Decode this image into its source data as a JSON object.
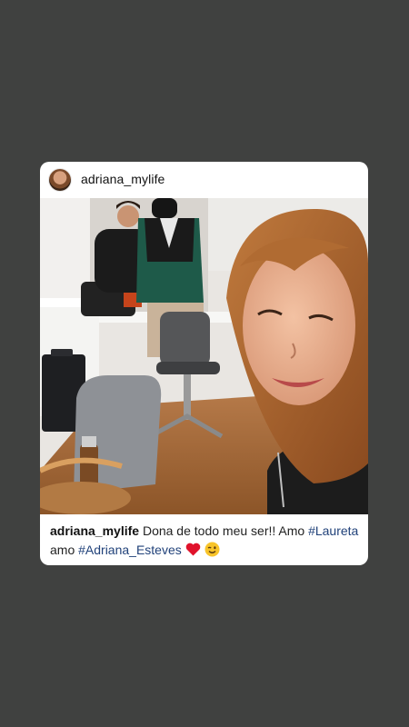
{
  "post": {
    "username": "adriana_mylife",
    "caption": {
      "user": "adriana_mylife",
      "text_1": "Dona de todo meu ser!! Amo ",
      "hashtag_1": "#Laureta",
      "text_2": "amo ",
      "hashtag_2": "#Adriana_Esteves"
    },
    "emojis": [
      "heart-emoji",
      "winking-face-emoji"
    ]
  },
  "colors": {
    "background": "#404140",
    "card": "#ffffff",
    "hashtag": "#21427a",
    "heart": "#e0122b"
  }
}
